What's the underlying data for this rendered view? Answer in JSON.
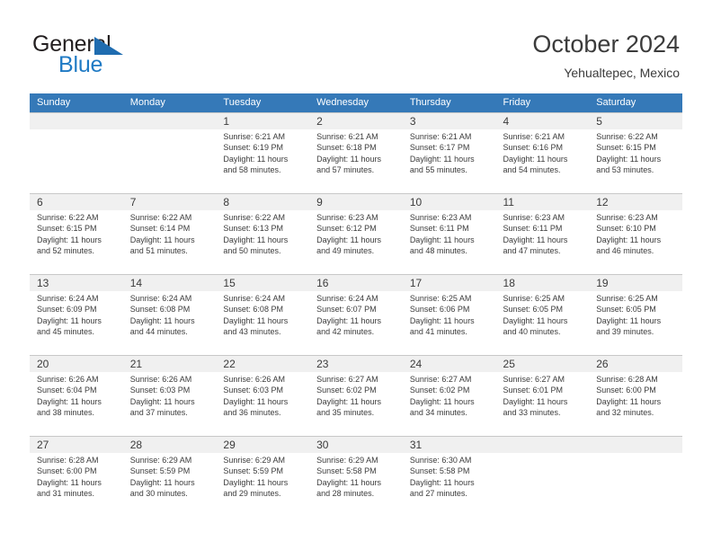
{
  "brand": {
    "name_part1": "General",
    "name_part2": "Blue",
    "triangle_icon": "triangle-icon",
    "color_dark": "#231f20",
    "color_blue": "#1f7ac4"
  },
  "header": {
    "title": "October 2024",
    "subtitle": "Yehualtepec, Mexico"
  },
  "theme": {
    "header_blue": "#3579b8",
    "datebar_gray": "#f0f0f0",
    "grid_line": "#c8c8c8",
    "text": "#3b3b3b"
  },
  "weekdays": [
    "Sunday",
    "Monday",
    "Tuesday",
    "Wednesday",
    "Thursday",
    "Friday",
    "Saturday"
  ],
  "weeks": [
    {
      "days": [
        {
          "num": "",
          "sunrise": "",
          "sunset": "",
          "daylight1": "",
          "daylight2": ""
        },
        {
          "num": "",
          "sunrise": "",
          "sunset": "",
          "daylight1": "",
          "daylight2": ""
        },
        {
          "num": "1",
          "sunrise": "Sunrise: 6:21 AM",
          "sunset": "Sunset: 6:19 PM",
          "daylight1": "Daylight: 11 hours",
          "daylight2": "and 58 minutes."
        },
        {
          "num": "2",
          "sunrise": "Sunrise: 6:21 AM",
          "sunset": "Sunset: 6:18 PM",
          "daylight1": "Daylight: 11 hours",
          "daylight2": "and 57 minutes."
        },
        {
          "num": "3",
          "sunrise": "Sunrise: 6:21 AM",
          "sunset": "Sunset: 6:17 PM",
          "daylight1": "Daylight: 11 hours",
          "daylight2": "and 55 minutes."
        },
        {
          "num": "4",
          "sunrise": "Sunrise: 6:21 AM",
          "sunset": "Sunset: 6:16 PM",
          "daylight1": "Daylight: 11 hours",
          "daylight2": "and 54 minutes."
        },
        {
          "num": "5",
          "sunrise": "Sunrise: 6:22 AM",
          "sunset": "Sunset: 6:15 PM",
          "daylight1": "Daylight: 11 hours",
          "daylight2": "and 53 minutes."
        }
      ]
    },
    {
      "days": [
        {
          "num": "6",
          "sunrise": "Sunrise: 6:22 AM",
          "sunset": "Sunset: 6:15 PM",
          "daylight1": "Daylight: 11 hours",
          "daylight2": "and 52 minutes."
        },
        {
          "num": "7",
          "sunrise": "Sunrise: 6:22 AM",
          "sunset": "Sunset: 6:14 PM",
          "daylight1": "Daylight: 11 hours",
          "daylight2": "and 51 minutes."
        },
        {
          "num": "8",
          "sunrise": "Sunrise: 6:22 AM",
          "sunset": "Sunset: 6:13 PM",
          "daylight1": "Daylight: 11 hours",
          "daylight2": "and 50 minutes."
        },
        {
          "num": "9",
          "sunrise": "Sunrise: 6:23 AM",
          "sunset": "Sunset: 6:12 PM",
          "daylight1": "Daylight: 11 hours",
          "daylight2": "and 49 minutes."
        },
        {
          "num": "10",
          "sunrise": "Sunrise: 6:23 AM",
          "sunset": "Sunset: 6:11 PM",
          "daylight1": "Daylight: 11 hours",
          "daylight2": "and 48 minutes."
        },
        {
          "num": "11",
          "sunrise": "Sunrise: 6:23 AM",
          "sunset": "Sunset: 6:11 PM",
          "daylight1": "Daylight: 11 hours",
          "daylight2": "and 47 minutes."
        },
        {
          "num": "12",
          "sunrise": "Sunrise: 6:23 AM",
          "sunset": "Sunset: 6:10 PM",
          "daylight1": "Daylight: 11 hours",
          "daylight2": "and 46 minutes."
        }
      ]
    },
    {
      "days": [
        {
          "num": "13",
          "sunrise": "Sunrise: 6:24 AM",
          "sunset": "Sunset: 6:09 PM",
          "daylight1": "Daylight: 11 hours",
          "daylight2": "and 45 minutes."
        },
        {
          "num": "14",
          "sunrise": "Sunrise: 6:24 AM",
          "sunset": "Sunset: 6:08 PM",
          "daylight1": "Daylight: 11 hours",
          "daylight2": "and 44 minutes."
        },
        {
          "num": "15",
          "sunrise": "Sunrise: 6:24 AM",
          "sunset": "Sunset: 6:08 PM",
          "daylight1": "Daylight: 11 hours",
          "daylight2": "and 43 minutes."
        },
        {
          "num": "16",
          "sunrise": "Sunrise: 6:24 AM",
          "sunset": "Sunset: 6:07 PM",
          "daylight1": "Daylight: 11 hours",
          "daylight2": "and 42 minutes."
        },
        {
          "num": "17",
          "sunrise": "Sunrise: 6:25 AM",
          "sunset": "Sunset: 6:06 PM",
          "daylight1": "Daylight: 11 hours",
          "daylight2": "and 41 minutes."
        },
        {
          "num": "18",
          "sunrise": "Sunrise: 6:25 AM",
          "sunset": "Sunset: 6:05 PM",
          "daylight1": "Daylight: 11 hours",
          "daylight2": "and 40 minutes."
        },
        {
          "num": "19",
          "sunrise": "Sunrise: 6:25 AM",
          "sunset": "Sunset: 6:05 PM",
          "daylight1": "Daylight: 11 hours",
          "daylight2": "and 39 minutes."
        }
      ]
    },
    {
      "days": [
        {
          "num": "20",
          "sunrise": "Sunrise: 6:26 AM",
          "sunset": "Sunset: 6:04 PM",
          "daylight1": "Daylight: 11 hours",
          "daylight2": "and 38 minutes."
        },
        {
          "num": "21",
          "sunrise": "Sunrise: 6:26 AM",
          "sunset": "Sunset: 6:03 PM",
          "daylight1": "Daylight: 11 hours",
          "daylight2": "and 37 minutes."
        },
        {
          "num": "22",
          "sunrise": "Sunrise: 6:26 AM",
          "sunset": "Sunset: 6:03 PM",
          "daylight1": "Daylight: 11 hours",
          "daylight2": "and 36 minutes."
        },
        {
          "num": "23",
          "sunrise": "Sunrise: 6:27 AM",
          "sunset": "Sunset: 6:02 PM",
          "daylight1": "Daylight: 11 hours",
          "daylight2": "and 35 minutes."
        },
        {
          "num": "24",
          "sunrise": "Sunrise: 6:27 AM",
          "sunset": "Sunset: 6:02 PM",
          "daylight1": "Daylight: 11 hours",
          "daylight2": "and 34 minutes."
        },
        {
          "num": "25",
          "sunrise": "Sunrise: 6:27 AM",
          "sunset": "Sunset: 6:01 PM",
          "daylight1": "Daylight: 11 hours",
          "daylight2": "and 33 minutes."
        },
        {
          "num": "26",
          "sunrise": "Sunrise: 6:28 AM",
          "sunset": "Sunset: 6:00 PM",
          "daylight1": "Daylight: 11 hours",
          "daylight2": "and 32 minutes."
        }
      ]
    },
    {
      "days": [
        {
          "num": "27",
          "sunrise": "Sunrise: 6:28 AM",
          "sunset": "Sunset: 6:00 PM",
          "daylight1": "Daylight: 11 hours",
          "daylight2": "and 31 minutes."
        },
        {
          "num": "28",
          "sunrise": "Sunrise: 6:29 AM",
          "sunset": "Sunset: 5:59 PM",
          "daylight1": "Daylight: 11 hours",
          "daylight2": "and 30 minutes."
        },
        {
          "num": "29",
          "sunrise": "Sunrise: 6:29 AM",
          "sunset": "Sunset: 5:59 PM",
          "daylight1": "Daylight: 11 hours",
          "daylight2": "and 29 minutes."
        },
        {
          "num": "30",
          "sunrise": "Sunrise: 6:29 AM",
          "sunset": "Sunset: 5:58 PM",
          "daylight1": "Daylight: 11 hours",
          "daylight2": "and 28 minutes."
        },
        {
          "num": "31",
          "sunrise": "Sunrise: 6:30 AM",
          "sunset": "Sunset: 5:58 PM",
          "daylight1": "Daylight: 11 hours",
          "daylight2": "and 27 minutes."
        },
        {
          "num": "",
          "sunrise": "",
          "sunset": "",
          "daylight1": "",
          "daylight2": ""
        },
        {
          "num": "",
          "sunrise": "",
          "sunset": "",
          "daylight1": "",
          "daylight2": ""
        }
      ]
    }
  ]
}
